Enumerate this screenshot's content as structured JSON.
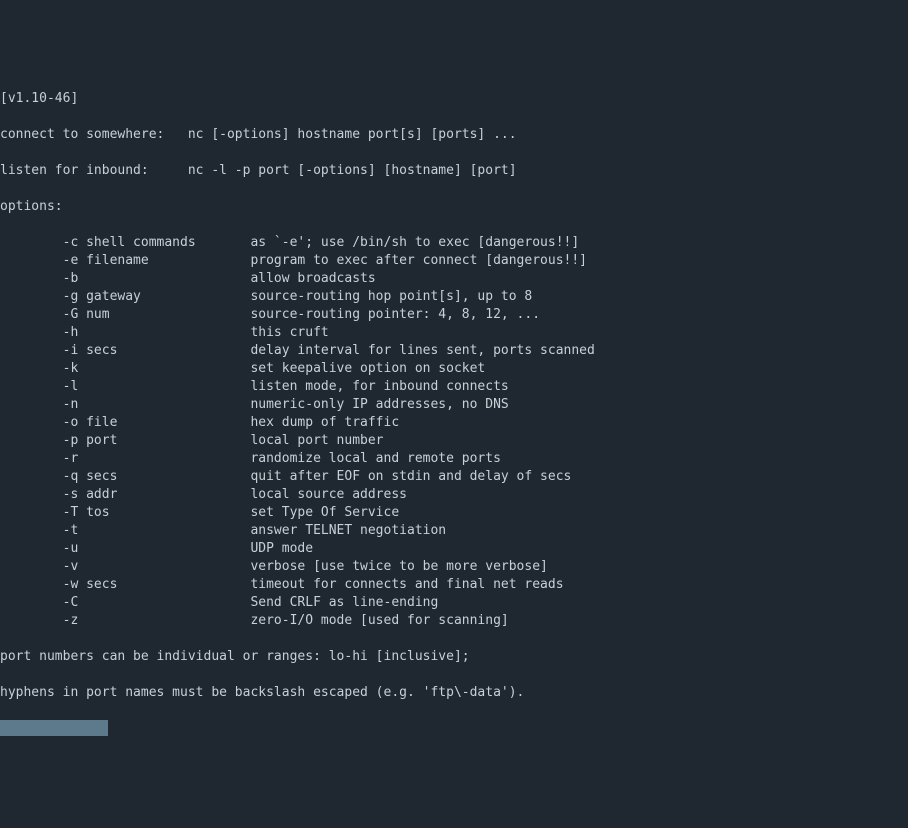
{
  "version_line": "[v1.10-46]",
  "usage_connect": "connect to somewhere:   nc [-options] hostname port[s] [ports] ... ",
  "usage_listen": "listen for inbound:     nc -l -p port [-options] [hostname] [port]",
  "options_header": "options:",
  "indent": "        ",
  "options": [
    {
      "flag": "-c shell commands",
      "desc": "as `-e'; use /bin/sh to exec [dangerous!!]"
    },
    {
      "flag": "-e filename",
      "desc": "program to exec after connect [dangerous!!]"
    },
    {
      "flag": "-b",
      "desc": "allow broadcasts"
    },
    {
      "flag": "-g gateway",
      "desc": "source-routing hop point[s], up to 8"
    },
    {
      "flag": "-G num",
      "desc": "source-routing pointer: 4, 8, 12, ..."
    },
    {
      "flag": "-h",
      "desc": "this cruft"
    },
    {
      "flag": "-i secs",
      "desc": "delay interval for lines sent, ports scanned"
    },
    {
      "flag": "-k",
      "desc": "set keepalive option on socket"
    },
    {
      "flag": "-l",
      "desc": "listen mode, for inbound connects"
    },
    {
      "flag": "-n",
      "desc": "numeric-only IP addresses, no DNS"
    },
    {
      "flag": "-o file",
      "desc": "hex dump of traffic"
    },
    {
      "flag": "-p port",
      "desc": "local port number"
    },
    {
      "flag": "-r",
      "desc": "randomize local and remote ports"
    },
    {
      "flag": "-q secs",
      "desc": "quit after EOF on stdin and delay of secs"
    },
    {
      "flag": "-s addr",
      "desc": "local source address"
    },
    {
      "flag": "-T tos",
      "desc": "set Type Of Service"
    },
    {
      "flag": "-t",
      "desc": "answer TELNET negotiation"
    },
    {
      "flag": "-u",
      "desc": "UDP mode"
    },
    {
      "flag": "-v",
      "desc": "verbose [use twice to be more verbose]"
    },
    {
      "flag": "-w secs",
      "desc": "timeout for connects and final net reads"
    },
    {
      "flag": "-C",
      "desc": "Send CRLF as line-ending"
    },
    {
      "flag": "-z",
      "desc": "zero-I/O mode [used for scanning]"
    }
  ],
  "footer1": "port numbers can be individual or ranges: lo-hi [inclusive];",
  "footer2": "hyphens in port names must be backslash escaped (e.g. 'ftp\\-data').",
  "flag_col_width": 24
}
